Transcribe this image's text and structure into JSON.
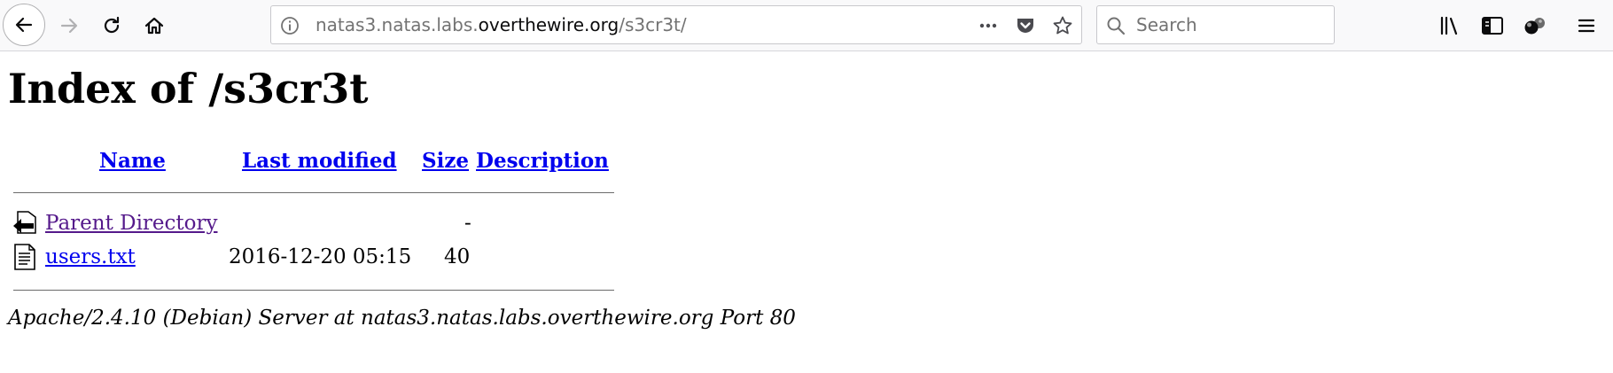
{
  "browser": {
    "url": {
      "host_prefix": "natas3.natas.labs.",
      "domain": "overthewire.org",
      "path": "/s3cr3t/"
    },
    "search": {
      "placeholder": "Search"
    }
  },
  "page": {
    "title": "Index of /s3cr3t",
    "columns": {
      "name": "Name",
      "last_modified": "Last modified",
      "size": "Size",
      "description": "Description"
    },
    "entries": [
      {
        "icon": "parent-directory-icon",
        "name": "Parent Directory",
        "last_modified": "",
        "size": "-",
        "visited": true
      },
      {
        "icon": "text-file-icon",
        "name": "users.txt",
        "last_modified": "2016-12-20 05:15",
        "size": "40",
        "visited": false
      }
    ],
    "server_signature": "Apache/2.4.10 (Debian) Server at natas3.natas.labs.overthewire.org Port 80"
  },
  "colors": {
    "link": "#0000ee",
    "visited_link": "#551a8b",
    "toolbar_bg": "#f9f9fa"
  }
}
